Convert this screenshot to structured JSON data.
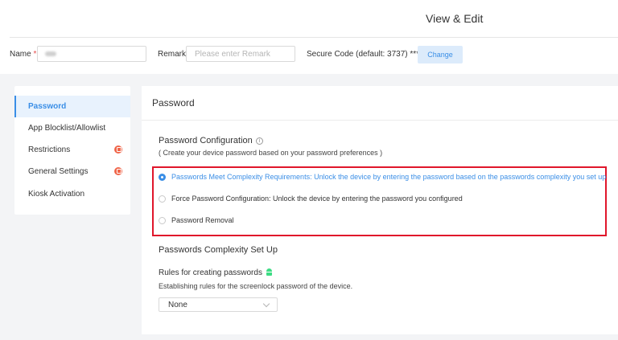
{
  "header": {
    "title": "View & Edit",
    "name_label": "Name",
    "name_required_mark": "*",
    "remark_label": "Remark",
    "remark_placeholder": "Please enter Remark",
    "secure_code_label": "Secure Code (default: 3737) ****",
    "change_label": "Change"
  },
  "sidebar": {
    "items": [
      {
        "label": "Password",
        "active": true,
        "badge": false
      },
      {
        "label": "App Blocklist/Allowlist",
        "active": false,
        "badge": false
      },
      {
        "label": "Restrictions",
        "active": false,
        "badge": true
      },
      {
        "label": "General Settings",
        "active": false,
        "badge": true
      },
      {
        "label": "Kiosk Activation",
        "active": false,
        "badge": false
      }
    ]
  },
  "main": {
    "title": "Password",
    "config_title": "Password Configuration",
    "config_subtitle": "( Create your device password based on your password preferences )",
    "options": [
      {
        "label": "Passwords Meet Complexity Requirements: Unlock the device by entering the password based on the passwords complexity you set up",
        "selected": true
      },
      {
        "label": "Force Password Configuration: Unlock the device by entering the password you configured",
        "selected": false
      },
      {
        "label": "Password Removal",
        "selected": false
      }
    ],
    "complexity_title": "Passwords Complexity Set Up",
    "rules_title": "Rules for creating passwords",
    "rules_desc": "Establishing rules for the screenlock password of the device.",
    "rules_select_value": "None"
  },
  "colors": {
    "accent": "#3a8ee6",
    "highlight_border": "#e0162b",
    "badge": "#f0664a",
    "android": "#3ddc84"
  },
  "icons": {
    "info": "info-icon",
    "android": "android-icon",
    "badge": "alert-badge-icon",
    "chevron": "chevron-down-icon"
  }
}
